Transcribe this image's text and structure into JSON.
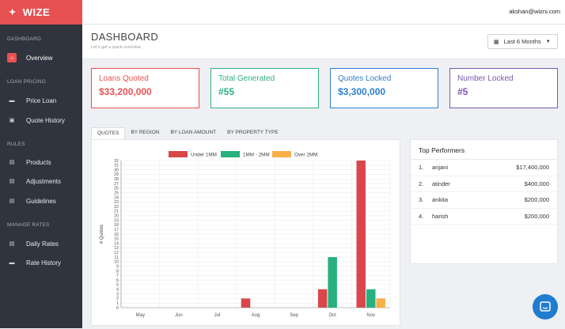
{
  "app": {
    "name": "WIZE"
  },
  "user": {
    "email": "akshan@wizni.com"
  },
  "sidebar": {
    "sections": [
      {
        "label": "DASHBOARD",
        "items": [
          {
            "label": "Overview",
            "icon": "home-icon",
            "active": true
          }
        ]
      },
      {
        "label": "LOAN PRICING",
        "items": [
          {
            "label": "Price Loan",
            "icon": "briefcase-icon"
          },
          {
            "label": "Quote History",
            "icon": "clipboard-icon"
          }
        ]
      },
      {
        "label": "RULES",
        "items": [
          {
            "label": "Products",
            "icon": "table-icon"
          },
          {
            "label": "Adjustments",
            "icon": "table-icon"
          },
          {
            "label": "Guidelines",
            "icon": "table-icon"
          }
        ]
      },
      {
        "label": "MANAGE RATES",
        "items": [
          {
            "label": "Daily Rates",
            "icon": "table-icon"
          },
          {
            "label": "Rate History",
            "icon": "briefcase-icon"
          }
        ]
      }
    ]
  },
  "page": {
    "title": "DASHBOARD",
    "subtitle": "Let's get a quick overview",
    "date_range": "Last 6 Months"
  },
  "cards": [
    {
      "label": "Loans Quoted",
      "value": "$33,200,000",
      "color": "#e85151"
    },
    {
      "label": "Total Generated",
      "value": "#55",
      "color": "#2fb083"
    },
    {
      "label": "Quotes Locked",
      "value": "$3,300,000",
      "color": "#2f7fce"
    },
    {
      "label": "Number Locked",
      "value": "#5",
      "color": "#7b57b5"
    }
  ],
  "tabs": [
    {
      "label": "QUOTES",
      "active": true
    },
    {
      "label": "BY REGION"
    },
    {
      "label": "BY LOAN AMOUNT"
    },
    {
      "label": "BY PROPERTY TYPE"
    }
  ],
  "chart_data": {
    "type": "bar",
    "categories": [
      "May",
      "Jun",
      "Jul",
      "Aug",
      "Sep",
      "Oct",
      "Nov"
    ],
    "series": [
      {
        "name": "Under 1MM",
        "color": "#d9474a",
        "values": [
          0,
          0,
          0,
          2,
          0,
          4,
          32
        ]
      },
      {
        "name": "1MM - 2MM",
        "color": "#28b07e",
        "values": [
          0,
          0,
          0,
          0,
          0,
          11,
          4
        ]
      },
      {
        "name": "Over 2MM",
        "color": "#f7b04a",
        "values": [
          0,
          0,
          0,
          0,
          0,
          0,
          2
        ]
      }
    ],
    "ylabel": "# Quotes",
    "ylim": [
      0,
      32
    ],
    "yticks": [
      "0",
      "1",
      "2",
      "3",
      "4",
      "5",
      "6",
      "7",
      "8",
      "9",
      "10",
      "11",
      "12",
      "13",
      "14",
      "15",
      "16",
      "17",
      "18",
      "19",
      "20",
      "21",
      "22",
      "23",
      "24",
      "25",
      "26",
      "27",
      "28",
      "29",
      "30",
      "31",
      "32"
    ],
    "legend": "top-center",
    "grid": true
  },
  "top_performers": {
    "title": "Top Performers",
    "rows": [
      {
        "rank": "1.",
        "name": "anjani",
        "amount": "$17,400,000"
      },
      {
        "rank": "2.",
        "name": "atinder",
        "amount": "$400,000"
      },
      {
        "rank": "3.",
        "name": "ankita",
        "amount": "$200,000"
      },
      {
        "rank": "4.",
        "name": "harish",
        "amount": "$200,000"
      }
    ]
  }
}
